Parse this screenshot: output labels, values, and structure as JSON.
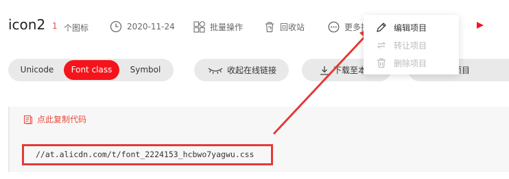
{
  "project": {
    "title": "icon2",
    "icon_count": "1",
    "icon_count_label": "个图标",
    "date": "2020-11-24"
  },
  "toolbar": {
    "batch_label": "批量操作",
    "recycle_label": "回收站",
    "more_label": "更多操"
  },
  "tabs": {
    "unicode": "Unicode",
    "font_class": "Font class",
    "symbol": "Symbol",
    "active": "font_class"
  },
  "actions": {
    "collapse_label": "收起在线链接",
    "download_label": "下载至本",
    "add_label": "标至项目"
  },
  "code": {
    "copy_label": "点此复制代码",
    "url": "//at.alicdn.com/t/font_2224153_hcbwo7yagwu.css"
  },
  "menu": {
    "items": [
      {
        "label": "编辑项目",
        "icon": "pencil-icon",
        "enabled": true
      },
      {
        "label": "转让项目",
        "icon": "transfer-icon",
        "enabled": false
      },
      {
        "label": "删除项目",
        "icon": "trash-icon",
        "enabled": false
      }
    ]
  },
  "colors": {
    "accent": "#f5141c",
    "annotation": "#e53935"
  }
}
